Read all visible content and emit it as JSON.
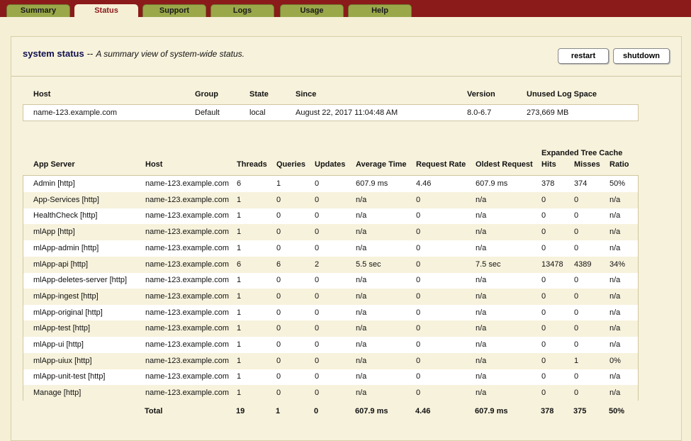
{
  "tabs": [
    {
      "label": "Summary",
      "active": false
    },
    {
      "label": "Status",
      "active": true
    },
    {
      "label": "Support",
      "active": false
    },
    {
      "label": "Logs",
      "active": false
    },
    {
      "label": "Usage",
      "active": false
    },
    {
      "label": "Help",
      "active": false
    }
  ],
  "header": {
    "title": "system status",
    "separator": "--",
    "subtitle": "A summary view of system-wide status.",
    "restart_label": "restart",
    "shutdown_label": "shutdown"
  },
  "host_table": {
    "columns": [
      "Host",
      "Group",
      "State",
      "Since",
      "Version",
      "Unused Log Space"
    ],
    "row": [
      "name-123.example.com",
      "Default",
      "local",
      "August 22, 2017 11:04:48 AM",
      "8.0-6.7",
      "273,669 MB"
    ]
  },
  "app_table": {
    "group_header": "Expanded Tree Cache",
    "columns": [
      "App Server",
      "Host",
      "Threads",
      "Queries",
      "Updates",
      "Average Time",
      "Request Rate",
      "Oldest Request",
      "Hits",
      "Misses",
      "Ratio"
    ],
    "rows": [
      [
        "Admin [http]",
        "name-123.example.com",
        "6",
        "1",
        "0",
        "607.9 ms",
        "4.46",
        "607.9 ms",
        "378",
        "374",
        "50%"
      ],
      [
        "App-Services [http]",
        "name-123.example.com",
        "1",
        "0",
        "0",
        "n/a",
        "0",
        "n/a",
        "0",
        "0",
        "n/a"
      ],
      [
        "HealthCheck [http]",
        "name-123.example.com",
        "1",
        "0",
        "0",
        "n/a",
        "0",
        "n/a",
        "0",
        "0",
        "n/a"
      ],
      [
        "mlApp [http]",
        "name-123.example.com",
        "1",
        "0",
        "0",
        "n/a",
        "0",
        "n/a",
        "0",
        "0",
        "n/a"
      ],
      [
        "mlApp-admin [http]",
        "name-123.example.com",
        "1",
        "0",
        "0",
        "n/a",
        "0",
        "n/a",
        "0",
        "0",
        "n/a"
      ],
      [
        "mlApp-api [http]",
        "name-123.example.com",
        "6",
        "6",
        "2",
        "5.5 sec",
        "0",
        "7.5 sec",
        "13478",
        "4389",
        "34%"
      ],
      [
        "mlApp-deletes-server [http]",
        "name-123.example.com",
        "1",
        "0",
        "0",
        "n/a",
        "0",
        "n/a",
        "0",
        "0",
        "n/a"
      ],
      [
        "mlApp-ingest [http]",
        "name-123.example.com",
        "1",
        "0",
        "0",
        "n/a",
        "0",
        "n/a",
        "0",
        "0",
        "n/a"
      ],
      [
        "mlApp-original [http]",
        "name-123.example.com",
        "1",
        "0",
        "0",
        "n/a",
        "0",
        "n/a",
        "0",
        "0",
        "n/a"
      ],
      [
        "mlApp-test [http]",
        "name-123.example.com",
        "1",
        "0",
        "0",
        "n/a",
        "0",
        "n/a",
        "0",
        "0",
        "n/a"
      ],
      [
        "mlApp-ui [http]",
        "name-123.example.com",
        "1",
        "0",
        "0",
        "n/a",
        "0",
        "n/a",
        "0",
        "0",
        "n/a"
      ],
      [
        "mlApp-uiux [http]",
        "name-123.example.com",
        "1",
        "0",
        "0",
        "n/a",
        "0",
        "n/a",
        "0",
        "1",
        "0%"
      ],
      [
        "mlApp-unit-test [http]",
        "name-123.example.com",
        "1",
        "0",
        "0",
        "n/a",
        "0",
        "n/a",
        "0",
        "0",
        "n/a"
      ],
      [
        "Manage [http]",
        "name-123.example.com",
        "1",
        "0",
        "0",
        "n/a",
        "0",
        "n/a",
        "0",
        "0",
        "n/a"
      ]
    ],
    "total": [
      "",
      "Total",
      "19",
      "1",
      "0",
      "607.9 ms",
      "4.46",
      "607.9 ms",
      "378",
      "375",
      "50%"
    ]
  },
  "colors": {
    "topbar": "#8b1a1a",
    "tab": "#9aa84a",
    "background": "#f5efd6"
  }
}
